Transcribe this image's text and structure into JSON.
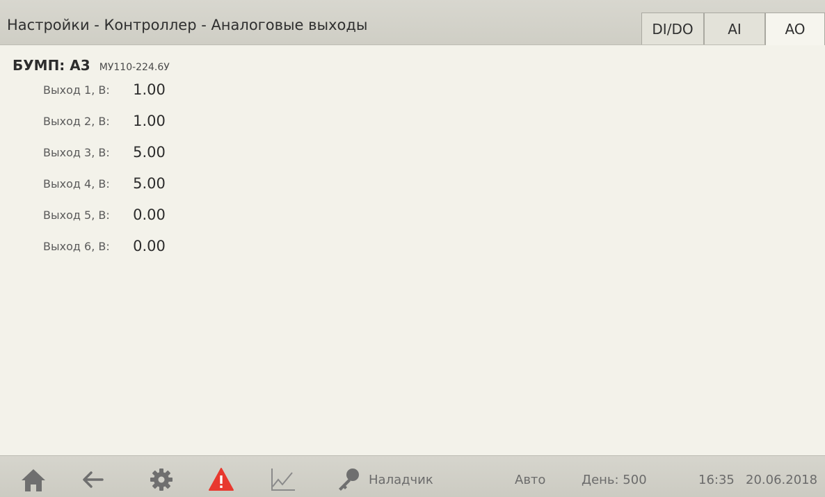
{
  "header": {
    "title": "Настройки - Контроллер - Аналоговые выходы",
    "tabs": [
      {
        "label": "DI/DO"
      },
      {
        "label": "AI"
      },
      {
        "label": "AO"
      }
    ]
  },
  "device": {
    "name": "БУМП: А3",
    "model": "МУ110-224.6У"
  },
  "outputs": [
    {
      "label": "Выход 1, В:",
      "value": "1.00"
    },
    {
      "label": "Выход 2, В:",
      "value": "1.00"
    },
    {
      "label": "Выход 3, В:",
      "value": "5.00"
    },
    {
      "label": "Выход 4, В:",
      "value": "5.00"
    },
    {
      "label": "Выход 5, В:",
      "value": "0.00"
    },
    {
      "label": "Выход 6, В:",
      "value": "0.00"
    }
  ],
  "footer": {
    "icons": [
      "home-icon",
      "back-arrow-icon",
      "gear-icon",
      "alarm-icon",
      "trend-chart-icon",
      "key-icon"
    ],
    "user": "Наладчик",
    "mode": "Авто",
    "day": "День: 500",
    "time": "16:35",
    "date": "20.06.2018"
  },
  "colors": {
    "alarm": "#e8382e",
    "icons": "#6f6f6f"
  }
}
